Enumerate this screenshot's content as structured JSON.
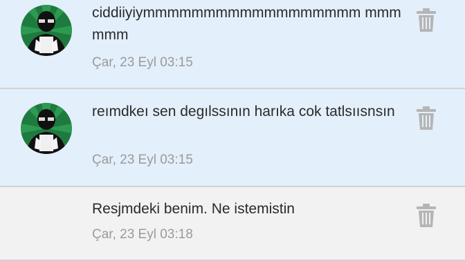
{
  "messages": [
    {
      "direction": "incoming",
      "text": "ciddiiyiymmmmmmmmmmmmmmmmmm mmmmmm",
      "time": "Çar, 23 Eyl 03:15",
      "avatar_icon": "user-avatar-icon",
      "delete_icon": "trash-icon"
    },
    {
      "direction": "incoming",
      "text": "reımdkeı sen degılssının harıka cok tatlsıısnsın",
      "time": "Çar, 23 Eyl 03:15",
      "avatar_icon": "user-avatar-icon",
      "delete_icon": "trash-icon"
    },
    {
      "direction": "outgoing",
      "text": "Resjmdeki benim. Ne istemistin",
      "time": "Çar, 23 Eyl 03:18",
      "delete_icon": "trash-icon"
    }
  ],
  "colors": {
    "incoming_background": "#e3effb",
    "outgoing_background": "#f2f2f2",
    "message_text": "#2a2a2a",
    "timestamp_text": "#9a9a9a",
    "trash_icon": "#b5b5b5",
    "avatar_ring": "#1f7a3f"
  }
}
